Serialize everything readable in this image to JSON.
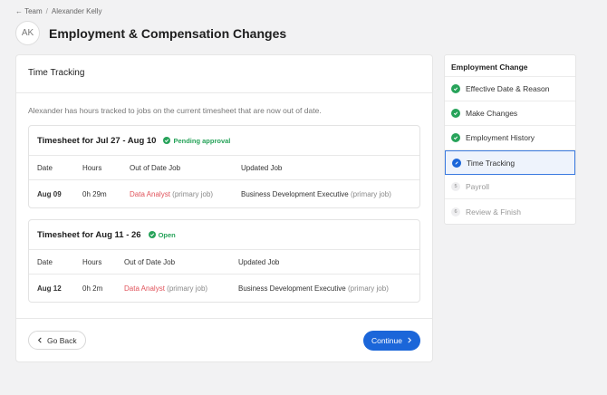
{
  "breadcrumb": {
    "back": "← Team",
    "sep": "/",
    "current": "Alexander Kelly"
  },
  "header": {
    "avatar": "AK",
    "title": "Employment & Compensation Changes"
  },
  "card": {
    "title": "Time Tracking",
    "intro": "Alexander has hours tracked to jobs on the current timesheet that are now out of date.",
    "timesheets": [
      {
        "title": "Timesheet for Jul 27 - Aug 10",
        "status": "Pending approval",
        "columns": [
          "Date",
          "Hours",
          "Out of Date Job",
          "Updated Job"
        ],
        "row": {
          "date": "Aug 09",
          "hours": "0h 29m",
          "old_job": "Data Analyst",
          "old_job_note": "(primary job)",
          "new_job": "Business Development Executive",
          "new_job_note": "(primary job)"
        }
      },
      {
        "title": "Timesheet for Aug 11 - 26",
        "status": "Open",
        "columns": [
          "Date",
          "Hours",
          "Out of Date Job",
          "Updated Job"
        ],
        "row": {
          "date": "Aug 12",
          "hours": "0h 2m",
          "old_job": "Data Analyst",
          "old_job_note": "(primary job)",
          "new_job": "Business Development Executive",
          "new_job_note": "(primary job)"
        }
      }
    ],
    "back_label": "Go Back",
    "continue_label": "Continue"
  },
  "steps": {
    "title": "Employment Change",
    "items": [
      {
        "label": "Effective Date & Reason",
        "state": "done",
        "icon": "check-icon"
      },
      {
        "label": "Make Changes",
        "state": "done",
        "icon": "check-icon"
      },
      {
        "label": "Employment History",
        "state": "done",
        "icon": "check-icon"
      },
      {
        "label": "Time Tracking",
        "state": "active",
        "icon": "pencil-icon"
      },
      {
        "label": "Payroll",
        "state": "todo",
        "number": "5"
      },
      {
        "label": "Review & Finish",
        "state": "todo",
        "number": "6"
      }
    ]
  },
  "colors": {
    "accent": "#1b66d9",
    "success": "#27a35a",
    "danger": "#e0525a"
  }
}
